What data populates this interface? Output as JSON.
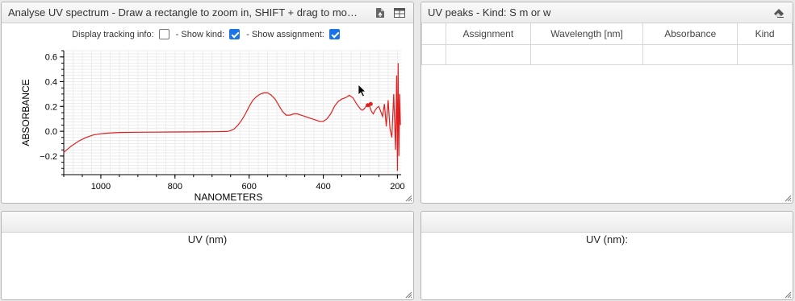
{
  "spectrum_panel": {
    "title": "Analyse UV spectrum - Draw a rectangle to zoom in, SHIFT + drag to mo…",
    "icons": [
      "export-icon",
      "table-icon"
    ],
    "options": {
      "tracking_label": "Display tracking info:",
      "tracking_checked": false,
      "kind_label": "- Show kind:",
      "kind_checked": true,
      "assignment_label": "- Show assignment:",
      "assignment_checked": true
    }
  },
  "peaks_panel": {
    "title": "UV peaks - Kind: S m or w",
    "columns": [
      "",
      "Assignment",
      "Wavelength [nm]",
      "Absorbance",
      "Kind"
    ]
  },
  "bottom_left": {
    "label": "UV (nm)"
  },
  "bottom_right": {
    "label": "UV (nm):"
  },
  "chart_data": {
    "type": "line",
    "xlabel": "NANOMETERS",
    "ylabel": "ABSORBANCE",
    "xlim": [
      1100,
      190
    ],
    "ylim": [
      -0.35,
      0.65
    ],
    "xticks": [
      1000,
      800,
      600,
      400,
      200
    ],
    "yticks": [
      0.6,
      0.4,
      0.2,
      0.0,
      -0.2
    ],
    "ytick_labels": [
      "0.6",
      "0.4",
      "0.2",
      "0.0",
      "−0.2"
    ],
    "grid": true,
    "series": [
      {
        "color": "#e02020",
        "x": [
          1100,
          1080,
          1060,
          1040,
          1020,
          1000,
          980,
          950,
          900,
          850,
          800,
          750,
          700,
          660,
          650,
          640,
          630,
          620,
          610,
          600,
          590,
          580,
          570,
          560,
          550,
          545,
          540,
          530,
          520,
          510,
          500,
          490,
          480,
          470,
          460,
          450,
          440,
          430,
          420,
          410,
          400,
          390,
          380,
          370,
          360,
          350,
          340,
          330,
          320,
          310,
          300,
          295,
          290,
          285,
          280,
          275,
          270,
          265,
          260,
          255,
          250,
          245,
          240,
          235,
          230,
          225,
          220,
          215,
          210,
          205,
          202,
          200,
          198,
          196,
          194,
          192
        ],
        "y": [
          -0.17,
          -0.12,
          -0.08,
          -0.05,
          -0.03,
          -0.02,
          -0.015,
          -0.01,
          -0.008,
          -0.007,
          -0.006,
          -0.005,
          -0.004,
          -0.002,
          0.005,
          0.02,
          0.05,
          0.09,
          0.14,
          0.2,
          0.25,
          0.28,
          0.3,
          0.31,
          0.31,
          0.3,
          0.29,
          0.26,
          0.21,
          0.16,
          0.13,
          0.13,
          0.14,
          0.14,
          0.13,
          0.12,
          0.11,
          0.1,
          0.09,
          0.08,
          0.08,
          0.1,
          0.14,
          0.2,
          0.24,
          0.26,
          0.27,
          0.29,
          0.27,
          0.22,
          0.18,
          0.17,
          0.18,
          0.2,
          0.22,
          0.2,
          0.16,
          0.14,
          0.17,
          0.19,
          0.2,
          0.16,
          0.12,
          0.22,
          0.04,
          0.25,
          0.02,
          -0.05,
          0.3,
          -0.15,
          0.45,
          -0.32,
          0.55,
          -0.2,
          0.3,
          0.05
        ]
      }
    ],
    "markers": [
      {
        "x": 280,
        "y": 0.21,
        "color": "#e02020"
      },
      {
        "x": 272,
        "y": 0.22,
        "color": "#e02020"
      }
    ]
  }
}
